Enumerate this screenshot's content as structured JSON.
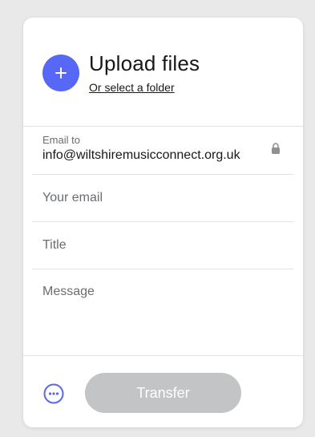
{
  "upload": {
    "title": "Upload files",
    "folder_link": "Or select a folder"
  },
  "recipient": {
    "label": "Email to",
    "value": "info@wiltshiremusicconnect.org.uk"
  },
  "form": {
    "email_placeholder": "Your email",
    "title_placeholder": "Title",
    "message_placeholder": "Message"
  },
  "footer": {
    "transfer_label": "Transfer"
  },
  "colors": {
    "accent": "#5668f5",
    "disabled_button": "#c3c4c6",
    "text": "#17181a",
    "muted_text": "#6a6d70"
  },
  "icons": {
    "add": "plus-icon",
    "lock": "lock-icon",
    "more": "more-options-icon"
  }
}
